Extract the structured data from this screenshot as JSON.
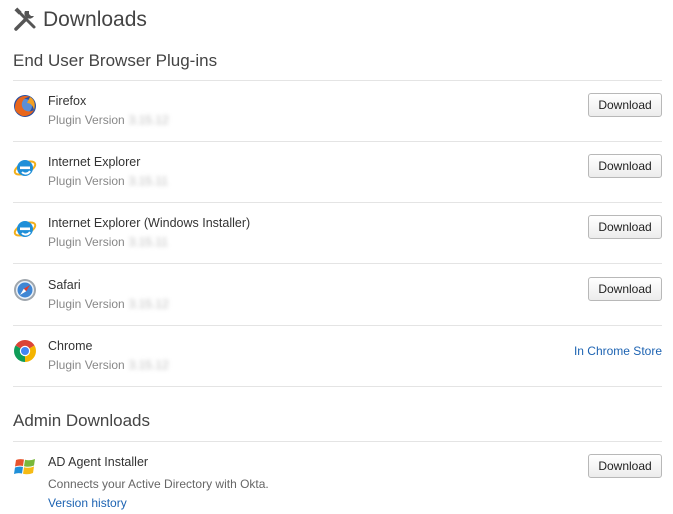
{
  "page": {
    "title": "Downloads"
  },
  "sections": {
    "plugins_title": "End User Browser Plug-ins",
    "admin_title": "Admin Downloads"
  },
  "plugins": [
    {
      "name": "Firefox",
      "version_label": "Plugin Version",
      "version": "3.15.12",
      "action": "Download",
      "icon": "firefox-icon"
    },
    {
      "name": "Internet Explorer",
      "version_label": "Plugin Version",
      "version": "3.15.11",
      "action": "Download",
      "icon": "internet-explorer-icon"
    },
    {
      "name": "Internet Explorer (Windows Installer)",
      "version_label": "Plugin Version",
      "version": "3.15.11",
      "action": "Download",
      "icon": "internet-explorer-icon"
    },
    {
      "name": "Safari",
      "version_label": "Plugin Version",
      "version": "3.15.12",
      "action": "Download",
      "icon": "safari-icon"
    },
    {
      "name": "Chrome",
      "version_label": "Plugin Version",
      "version": "3.15.12",
      "action": "In Chrome Store",
      "icon": "chrome-icon"
    }
  ],
  "admin": [
    {
      "name": "AD Agent Installer",
      "description": "Connects your Active Directory with Okta.",
      "link": "Version history",
      "action": "Download",
      "icon": "windows-icon"
    }
  ],
  "colors": {
    "link": "#1d63b2",
    "text": "#333333",
    "muted": "#888888"
  }
}
